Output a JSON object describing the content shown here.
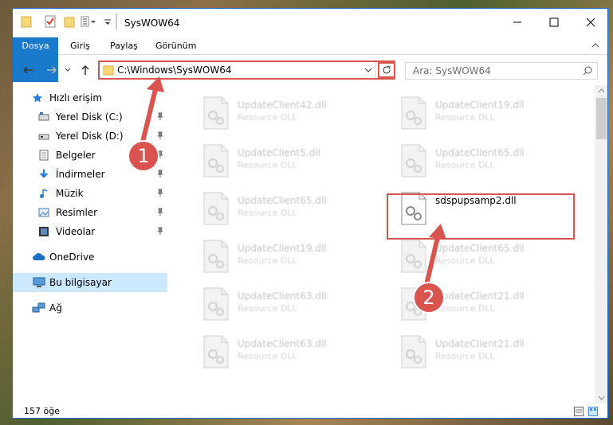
{
  "window": {
    "title": "SysWOW64"
  },
  "ribbon": {
    "tabs": [
      "Dosya",
      "Giriş",
      "Paylaş",
      "Görünüm"
    ]
  },
  "address": {
    "path": "C:\\Windows\\SysWOW64"
  },
  "search": {
    "placeholder": "Ara: SysWOW64"
  },
  "sidebar": {
    "quick_access": "Hızlı erişim",
    "items": [
      {
        "label": "Yerel Disk (C:)",
        "icon": "drive-icon",
        "pinned": true
      },
      {
        "label": "Yerel Disk (D:)",
        "icon": "drive-icon",
        "pinned": true
      },
      {
        "label": "Belgeler",
        "icon": "documents-icon",
        "pinned": true
      },
      {
        "label": "İndirmeler",
        "icon": "download-icon",
        "pinned": true
      },
      {
        "label": "Müzik",
        "icon": "music-icon",
        "pinned": true
      },
      {
        "label": "Resimler",
        "icon": "pictures-icon",
        "pinned": true
      },
      {
        "label": "Videolar",
        "icon": "videos-icon",
        "pinned": true
      }
    ],
    "onedrive": "OneDrive",
    "this_pc": "Bu bilgisayar",
    "network": "Ağ"
  },
  "files": {
    "left": [
      {
        "name": "UpdateClient42.dll",
        "type": "Resource DLL"
      },
      {
        "name": "UpdateClient5.dll",
        "type": "Resource DLL"
      },
      {
        "name": "UpdateClient65.dll",
        "type": "Resource DLL"
      },
      {
        "name": "UpdateClient19.dll",
        "type": "Resource DLL"
      },
      {
        "name": "UpdateClient63.dll",
        "type": "Resource DLL"
      },
      {
        "name": "UpdateClient63.dll",
        "type": "Resource DLL"
      }
    ],
    "right": [
      {
        "name": "UpdateClient19.dll",
        "type": "Resource DLL"
      },
      {
        "name": "UpdateClient65.dll",
        "type": "Resource DLL"
      },
      {
        "name": "sdspupsamp2.dll",
        "type": ""
      },
      {
        "name": "UpdateClient65.dll",
        "type": "Resource DLL"
      },
      {
        "name": "UpdateClient21.dll",
        "type": "Resource DLL"
      },
      {
        "name": "UpdateClient21.dll",
        "type": "Resource DLL"
      }
    ]
  },
  "status": {
    "count": "157 öğe"
  },
  "annotations": {
    "step1": "1",
    "step2": "2"
  },
  "colors": {
    "accent": "#1979ca",
    "highlight": "#d9534f",
    "selected_bg": "#cce8ff"
  }
}
